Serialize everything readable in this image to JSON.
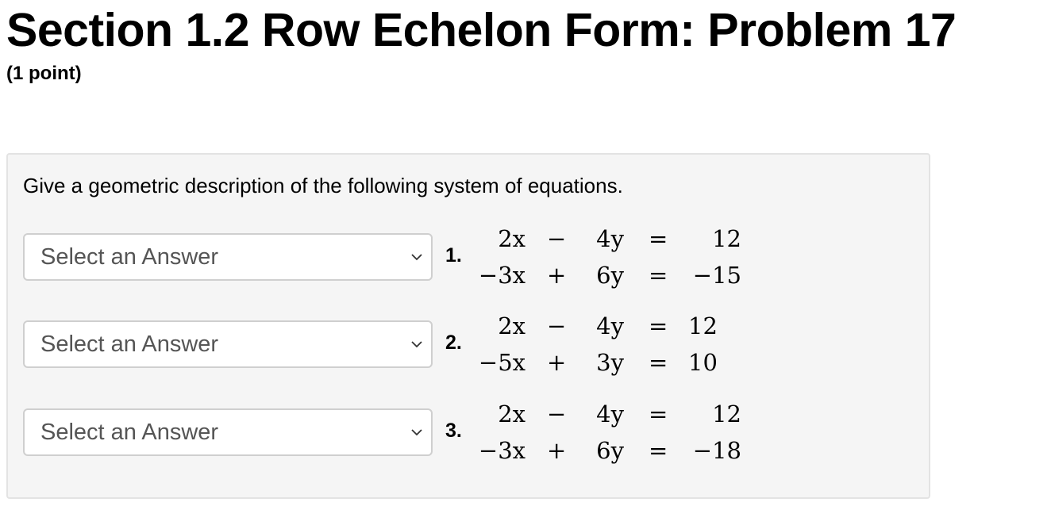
{
  "header": {
    "title": "Section 1.2 Row Echelon Form: Problem 17",
    "points": "(1 point)"
  },
  "problem": {
    "instruction": "Give a geometric description of the following system of equations.",
    "parts": [
      {
        "number": "1.",
        "select_value": "Select an Answer",
        "rows": [
          [
            "2x",
            "−",
            "4y",
            "=",
            "12"
          ],
          [
            "−3x",
            "+",
            "6y",
            "=",
            "−15"
          ]
        ]
      },
      {
        "number": "2.",
        "select_value": "Select an Answer",
        "rows": [
          [
            "2x",
            "−",
            "4y",
            "=",
            "12"
          ],
          [
            "−5x",
            "+",
            "3y",
            "=",
            "10"
          ]
        ]
      },
      {
        "number": "3.",
        "select_value": "Select an Answer",
        "rows": [
          [
            "2x",
            "−",
            "4y",
            "=",
            "12"
          ],
          [
            "−3x",
            "+",
            "6y",
            "=",
            "−18"
          ]
        ]
      }
    ]
  },
  "colors": {
    "box_background": "#f5f5f5",
    "box_border": "#e3e3e3",
    "select_border": "#cfcfcf",
    "select_text": "#555555"
  },
  "icons": {
    "select_arrow": "chevron-down-icon"
  }
}
